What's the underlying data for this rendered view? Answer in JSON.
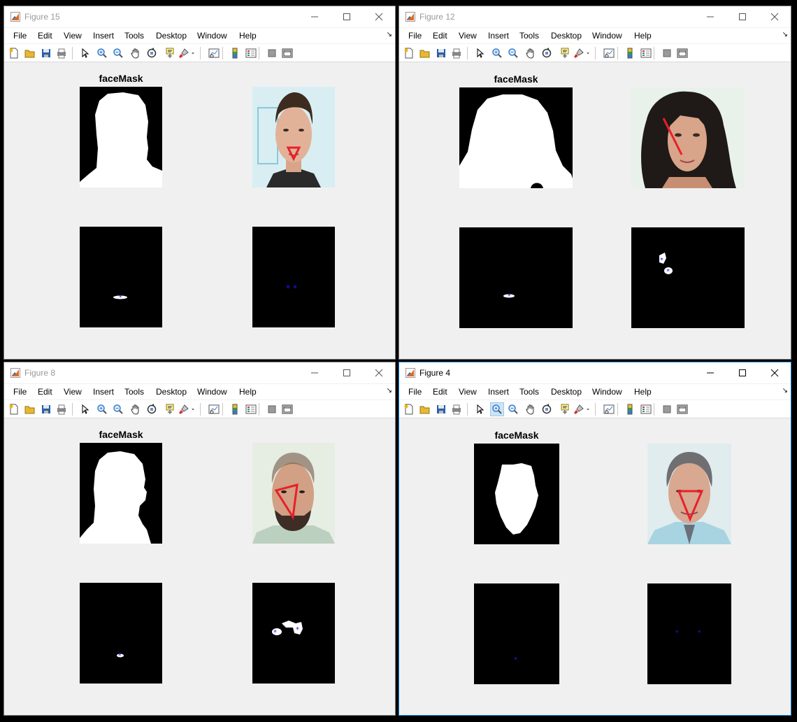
{
  "menu_items": [
    "File",
    "Edit",
    "View",
    "Insert",
    "Tools",
    "Desktop",
    "Window",
    "Help"
  ],
  "axes_title": "faceMask",
  "toolbar_icons": [
    "new-figure-icon",
    "open-file-icon",
    "save-icon",
    "print-icon",
    "pointer-icon",
    "zoom-in-icon",
    "zoom-out-icon",
    "pan-hand-icon",
    "rotate-3d-icon",
    "data-cursor-icon",
    "brush-icon",
    "brush-dropdown-icon",
    "link-plot-icon",
    "colorbar-icon",
    "legend-icon",
    "hide-plot-tools-icon",
    "show-plot-tools-icon"
  ],
  "colors": {
    "window_bg": "#f0f0f0",
    "active_border": "#1883d7",
    "marker_blue": "#1a1aff",
    "triangle_red": "#e8202a"
  },
  "windows": [
    {
      "title": "Figure 15"
    },
    {
      "title": "Figure 12"
    },
    {
      "title": "Figure 8"
    },
    {
      "title": "Figure 4"
    }
  ]
}
